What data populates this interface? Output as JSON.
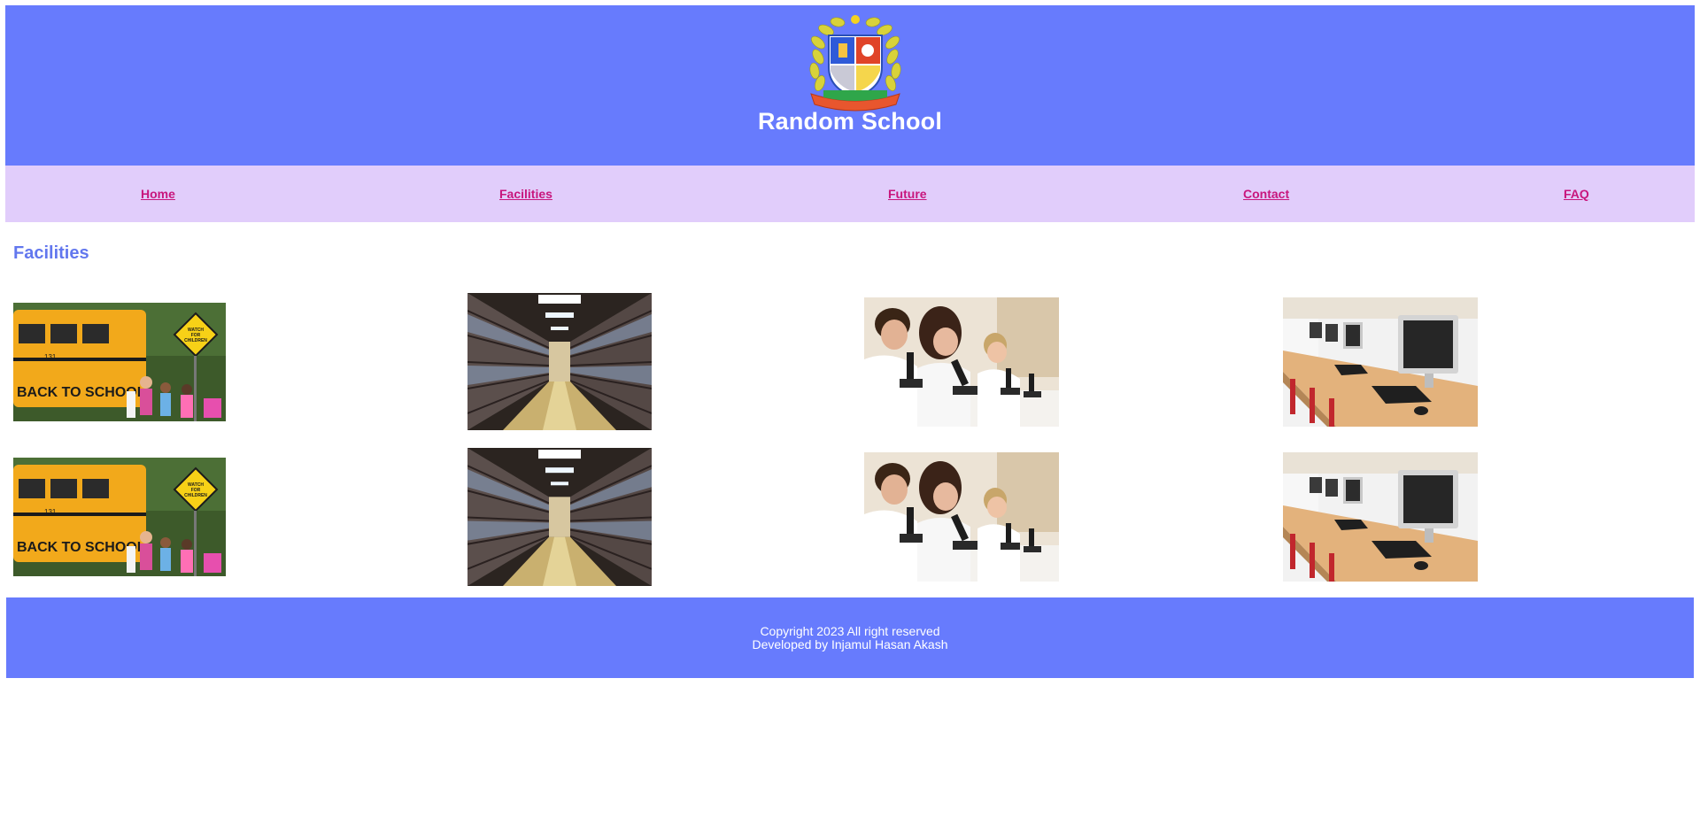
{
  "header": {
    "school_name": "Random School",
    "logo_icon": "school-crest-icon"
  },
  "nav": {
    "items": [
      {
        "label": "Home"
      },
      {
        "label": "Facilities"
      },
      {
        "label": "Future"
      },
      {
        "label": "Contact"
      },
      {
        "label": "FAQ"
      }
    ]
  },
  "main": {
    "section_title": "Facilities",
    "gallery": [
      {
        "subject": "school-bus-photo",
        "sign_text": "WATCH FOR CHILDREN",
        "bus_text": "BACK TO SCHOOL",
        "bus_number": "131"
      },
      {
        "subject": "library-aisle-photo"
      },
      {
        "subject": "science-lab-microscope-photo"
      },
      {
        "subject": "computer-lab-photo"
      }
    ]
  },
  "footer": {
    "copyright": "Copyright 2023 All right reserved",
    "developer": "Developed by Injamul Hasan Akash"
  },
  "colors": {
    "header_bg": "#677bfd",
    "nav_bg": "#e1cdfb",
    "nav_link": "#c8167d",
    "section_title": "#6277ee",
    "footer_bg": "#677bfd"
  }
}
